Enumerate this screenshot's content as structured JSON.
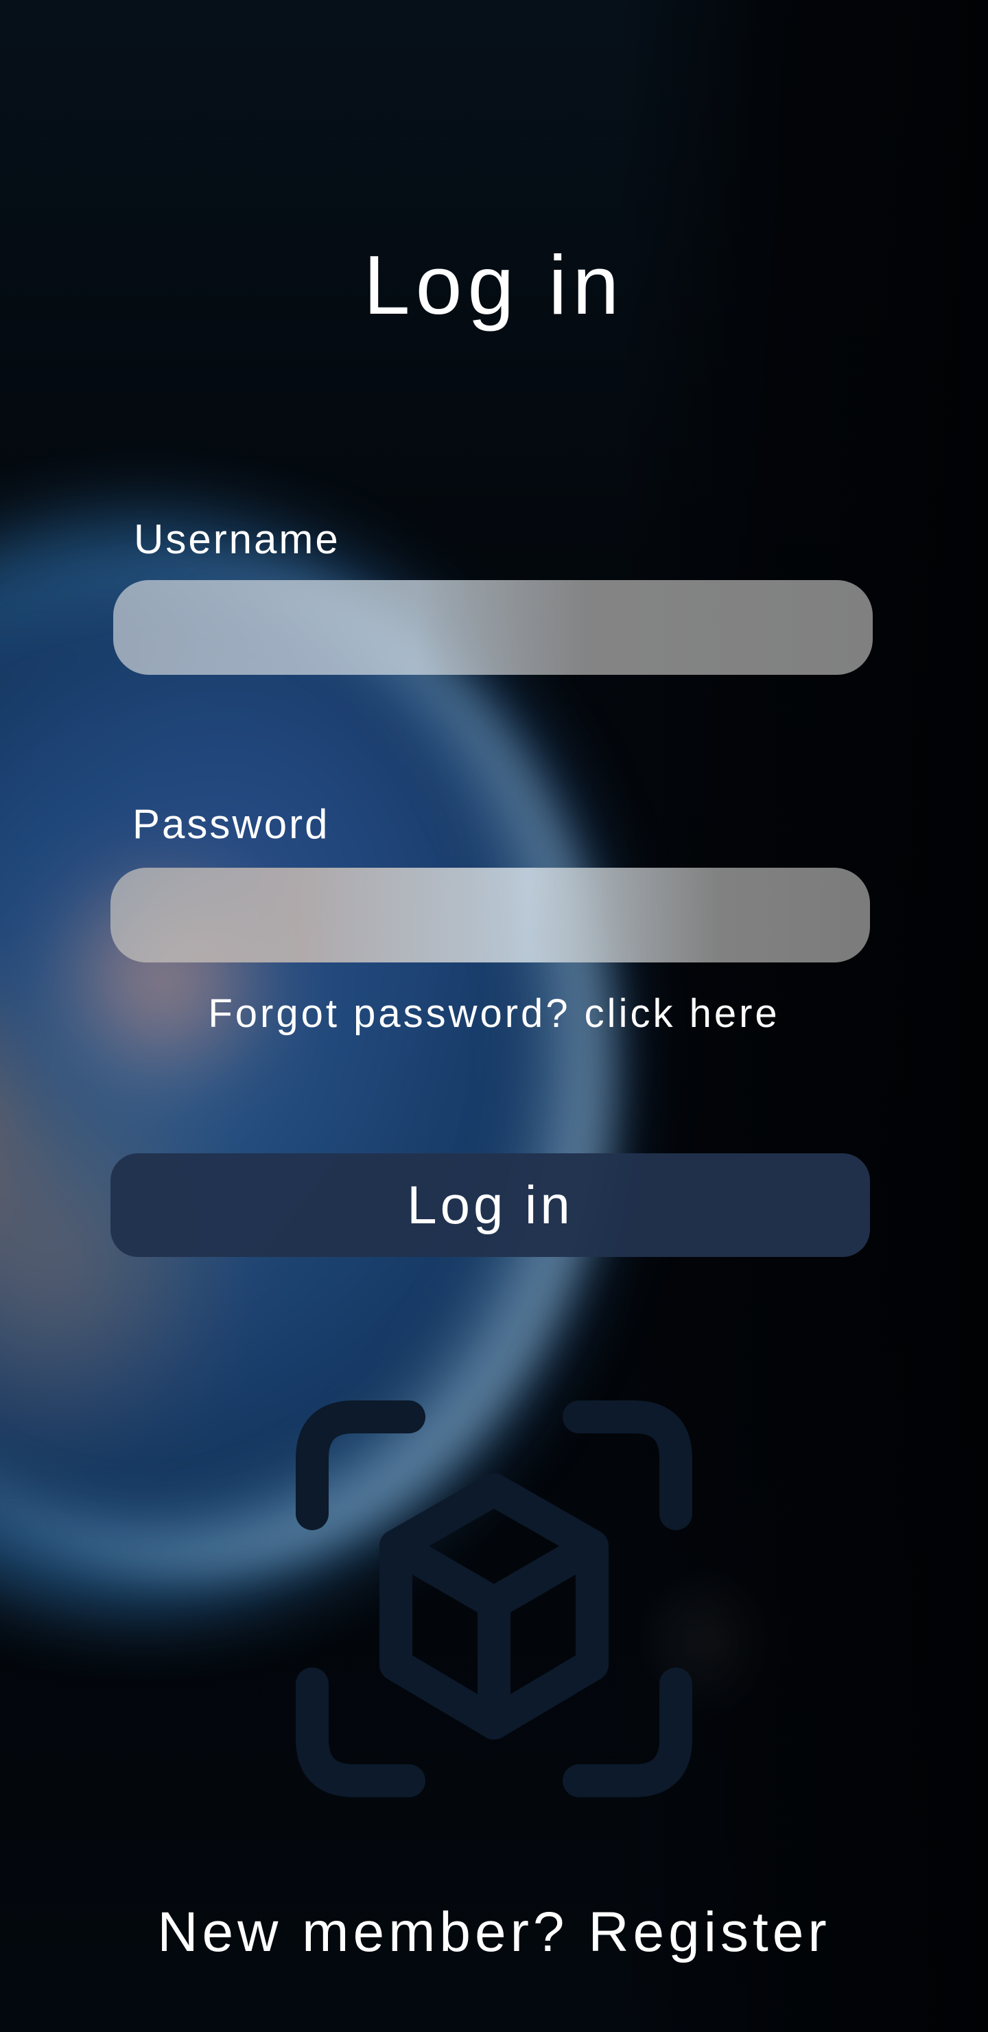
{
  "screen": {
    "title": "Log in"
  },
  "form": {
    "username_label": "Username",
    "username_value": "",
    "password_label": "Password",
    "password_value": "",
    "forgot_text": "Forgot password? click here",
    "submit_label": "Log in"
  },
  "footer": {
    "prompt": "New member?",
    "register_label": "Register"
  },
  "icons": {
    "ar_icon": "ar-cube-scan-icon"
  },
  "colors": {
    "button_background": "#21324e",
    "icon_color": "#0c1a2b",
    "text": "#ffffff"
  }
}
